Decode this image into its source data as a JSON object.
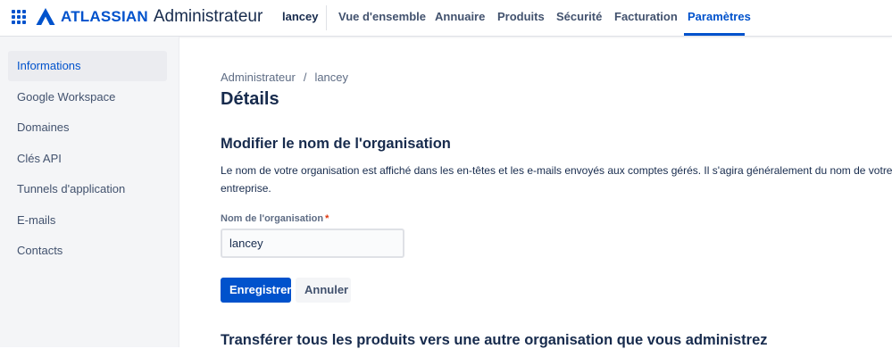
{
  "header": {
    "app_switcher_icon": "app-switcher-grid-icon",
    "logo_word": "ATLASSIAN",
    "logo_product": "Administrateur",
    "org_name": "lancey",
    "nav": [
      {
        "label": "Vue d'ensemble",
        "active": false
      },
      {
        "label": "Annuaire",
        "active": false
      },
      {
        "label": "Produits",
        "active": false
      },
      {
        "label": "Sécurité",
        "active": false
      },
      {
        "label": "Facturation",
        "active": false
      },
      {
        "label": "Paramètres",
        "active": true
      }
    ]
  },
  "sidebar": {
    "items": [
      {
        "label": "Informations",
        "active": true
      },
      {
        "label": "Google Workspace",
        "active": false
      },
      {
        "label": "Domaines",
        "active": false
      },
      {
        "label": "Clés API",
        "active": false
      },
      {
        "label": "Tunnels d'application",
        "active": false
      },
      {
        "label": "E-mails",
        "active": false
      },
      {
        "label": "Contacts",
        "active": false
      }
    ]
  },
  "main": {
    "breadcrumb": {
      "root": "Administrateur",
      "separator": "/",
      "current": "lancey"
    },
    "title": "Détails",
    "section": {
      "title": "Modifier le nom de l'organisation",
      "description": "Le nom de votre organisation est affiché dans les en-têtes et les e-mails envoyés aux comptes gérés. Il s'agira généralement du nom de votre entreprise.",
      "field_label": "Nom de l'organisation",
      "required_marker": "*",
      "field_value": "lancey",
      "save_label": "Enregistrer",
      "cancel_label": "Annuler"
    },
    "section2_title": "Transférer tous les produits vers une autre organisation que vous administrez"
  },
  "colors": {
    "brand": "#0052cc",
    "text": "#172b4d",
    "subtle_text": "#42526e",
    "sidebar_bg": "#f4f5f7",
    "required": "#de350b"
  }
}
